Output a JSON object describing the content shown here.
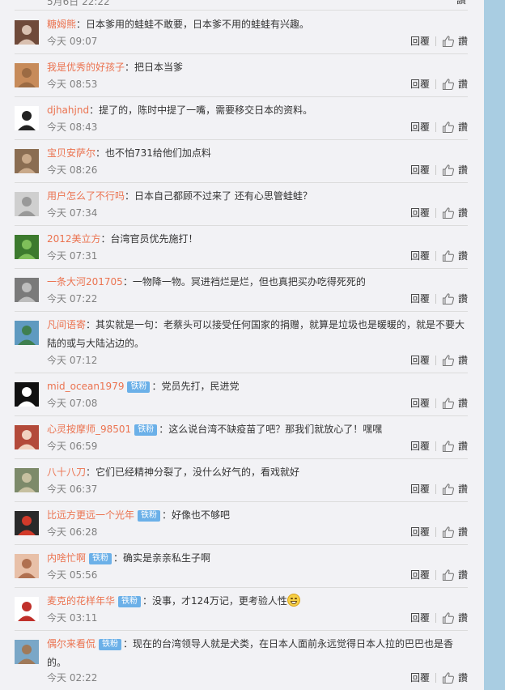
{
  "top_partial": {
    "time": "5月6日 22:22"
  },
  "actions": {
    "reply": "回覆",
    "like": "讚"
  },
  "comments": [
    {
      "name": "糖姆熊",
      "badge": "",
      "text": "：日本爹用的蛙蛙不敢要，日本爹不用的蛙蛙有兴趣。",
      "time": "今天 09:07"
    },
    {
      "name": "我是优秀的好孩子",
      "badge": "",
      "text": "：把日本当爹",
      "time": "今天 08:53"
    },
    {
      "name": "djhahjnd",
      "badge": "",
      "text": "：提了的，陈时中提了一嘴，需要移交日本的资料。",
      "time": "今天 08:43"
    },
    {
      "name": "宝贝安萨尔",
      "badge": "",
      "text": "：也不怕731给他们加点料",
      "time": "今天 08:26"
    },
    {
      "name": "用户怎么了不行吗",
      "badge": "",
      "text": "：日本自己都顾不过来了 还有心思管蛙蛙？",
      "time": "今天 07:34"
    },
    {
      "name": "2012美立方",
      "badge": "",
      "text": "：台湾官员优先施打！",
      "time": "今天 07:31"
    },
    {
      "name": "一条大河201705",
      "badge": "",
      "text": "：一物降一物。冥进裆烂是烂，但也真把买办吃得死死的",
      "time": "今天 07:22"
    },
    {
      "name": "凡间语寄",
      "badge": "",
      "text": "：其实就是一句：老蔡头可以接受任何国家的捐赠，就算是垃圾也是暖暖的，就是不要大陆的或与大陆沾边的。",
      "time": "今天 07:12"
    },
    {
      "name": "mid_ocean1979",
      "badge": "铁粉",
      "text": "：党员先打，民进党",
      "time": "今天 07:08"
    },
    {
      "name": "心灵按摩师_98501",
      "badge": "铁粉",
      "text": "：这么说台湾不缺疫苗了吧？那我们就放心了！嘿嘿",
      "time": "今天 06:59"
    },
    {
      "name": "八十八刀",
      "badge": "",
      "text": "：它们已经精神分裂了，没什么好气的，看戏就好",
      "time": "今天 06:37"
    },
    {
      "name": "比远方更远一个光年",
      "badge": "铁粉",
      "text": "：好像也不够吧",
      "time": "今天 06:28"
    },
    {
      "name": "内啥忙啊",
      "badge": "铁粉",
      "text": "：确实是亲亲私生子啊",
      "time": "今天 05:56"
    },
    {
      "name": "麦克的花样年华",
      "badge": "铁粉",
      "text": "：没事，才124万记，更考验人性",
      "emoji": "grin",
      "time": "今天 03:11"
    },
    {
      "name": "偶尔来看侃",
      "badge": "铁粉",
      "text": "：现在的台湾领导人就是犬类，在日本人面前永远觉得日本人拉的巴巴也是香的。",
      "time": "今天 02:22"
    }
  ],
  "colors": {
    "name": "#eb7350",
    "badge": "#6bb0e8",
    "time": "#808080",
    "panel": "#f2f2f5",
    "side": "#a9cde2"
  }
}
